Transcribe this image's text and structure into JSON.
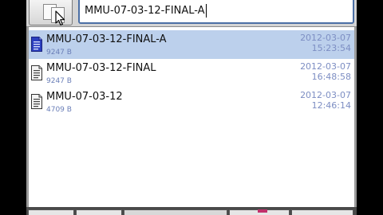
{
  "search": {
    "value": "MMU-07-03-12-FINAL-A"
  },
  "files": [
    {
      "name": "MMU-07-03-12-FINAL-A",
      "size": "9247 B",
      "date": "2012-03-07",
      "time": "15:23:54",
      "selected": true,
      "icon": "document-icon"
    },
    {
      "name": "MMU-07-03-12-FINAL",
      "size": "9247 B",
      "date": "2012-03-07",
      "time": "16:48:58",
      "selected": false,
      "icon": "text-file-icon"
    },
    {
      "name": "MMU-07-03-12",
      "size": "4709 B",
      "date": "2012-03-07",
      "time": "12:46:14",
      "selected": false,
      "icon": "text-file-icon"
    }
  ],
  "colors": {
    "selection": "#bcd0ec",
    "field_border": "#4b6fa5",
    "meta_text": "#7d8ec3",
    "accent": "#c0306a"
  },
  "icons": {
    "toolbar_button": "copy-files-icon",
    "pointer": "mouse-pointer-icon"
  }
}
